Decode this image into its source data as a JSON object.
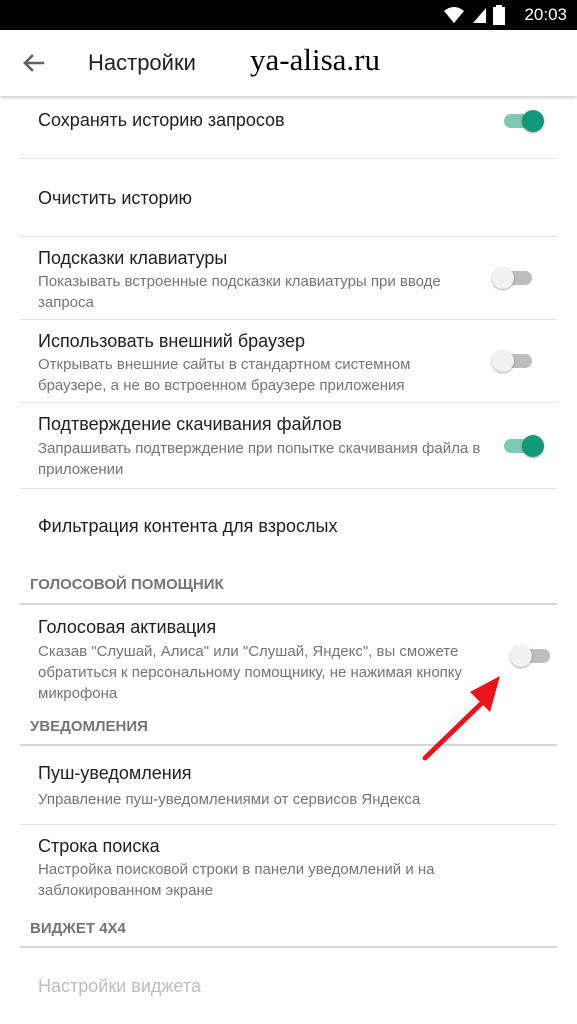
{
  "status": {
    "time": "20:03"
  },
  "header": {
    "title": "Настройки",
    "watermark": "ya-alisa.ru"
  },
  "colors": {
    "accent": "#12987a",
    "arrow": "#e8141c"
  },
  "rows": [
    {
      "title": "Сохранять историю запросов",
      "switch": "on"
    },
    {
      "title": "Очистить историю"
    },
    {
      "title": "Подсказки клавиатуры",
      "subtitle": "Показывать встроенные подсказки клавиатуры при вводе запроса",
      "switch": "off"
    },
    {
      "title": "Использовать внешний браузер",
      "subtitle": "Открывать внешние сайты в стандартном системном браузере, а не во встроенном браузере приложения",
      "switch": "off"
    },
    {
      "title": "Подтверждение скачивания файлов",
      "subtitle": "Запрашивать подтверждение при попытке скачивания файла в приложении",
      "switch": "on"
    },
    {
      "title": "Фильтрация контента для взрослых"
    },
    {
      "title": "Голосовая активация",
      "subtitle": "Сказав \"Слушай, Алиса\" или \"Слушай, Яндекс\", вы сможете обратиться к персональному помощнику, не нажимая кнопку микрофона",
      "switch": "off"
    },
    {
      "title": "Пуш-уведомления",
      "subtitle": "Управление пуш-уведомлениями от сервисов Яндекса"
    },
    {
      "title": "Строка поиска",
      "subtitle": "Настройка поисковой строки в панели уведомлений и на заблокированном экране"
    },
    {
      "title": "Настройки виджета",
      "disabled": true
    }
  ],
  "sections": {
    "voice": "ГОЛОСОВОЙ ПОМОЩНИК",
    "notifications": "УВЕДОМЛЕНИЯ",
    "widget": "ВИДЖЕТ 4X4"
  }
}
